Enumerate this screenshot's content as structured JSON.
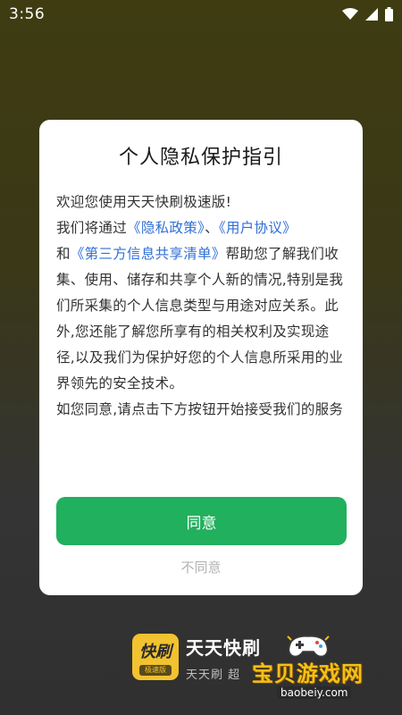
{
  "status_bar": {
    "time": "3:56",
    "icons": [
      "wifi-icon",
      "signal-icon",
      "battery-icon"
    ]
  },
  "dialog": {
    "title": "个人隐私保护指引",
    "greeting": "欢迎您使用天天快刷极速版!",
    "intro_prefix": "我们将通过",
    "privacy_policy_link": "《隐私政策》",
    "separator": "、",
    "user_agreement_link": "《用户协议》",
    "and_text": "和",
    "third_party_link": "《第三方信息共享清单》",
    "body_text": "帮助您了解我们收集、使用、储存和共享个人新的情况,特别是我们所采集的个人信息类型与用途对应关系。此外,您还能了解您所享有的相关权利及实现途径,以及我们为保护好您的个人信息所采用的业界领先的安全技术。",
    "consent_text": "如您同意,请点击下方按钮开始接受我们的服务",
    "agree_button": "同意",
    "disagree_button": "不同意"
  },
  "app_brand": {
    "logo_text": "快刷",
    "logo_sub": "极速版",
    "name": "天天快刷",
    "slogan": "天天刷 超"
  },
  "watermark": {
    "text": "宝贝游戏网",
    "url": "baobeiy.com"
  },
  "colors": {
    "accent_green": "#21b05d",
    "link_blue": "#2f6fd6",
    "watermark_gold": "#f4c017"
  }
}
